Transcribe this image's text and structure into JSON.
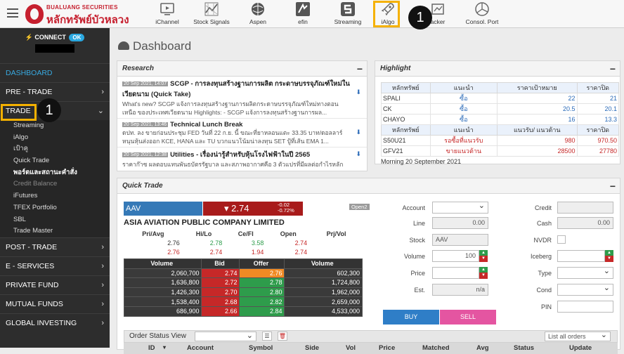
{
  "topbar": {
    "brand_line1": "BUALUANG SECURITIES",
    "brand_line2": "หลักทรัพย์บัวหลวง",
    "items": [
      {
        "label": "iChannel",
        "icon": "monitor-icon"
      },
      {
        "label": "Stock Signals",
        "icon": "signal-icon"
      },
      {
        "label": "Aspen",
        "icon": "globe-icon"
      },
      {
        "label": "efin",
        "icon": "efin-icon"
      },
      {
        "label": "Streaming",
        "icon": "streaming-icon"
      },
      {
        "label": "iAlgo",
        "icon": "rocket-icon"
      },
      {
        "label": "acker",
        "icon": "tracker-icon"
      },
      {
        "label": "Consol. Port",
        "icon": "pie-chart-icon"
      }
    ],
    "step_badge": "1"
  },
  "sidebar": {
    "connect_label": "CONNECT",
    "connect_status": "OK",
    "sections": [
      {
        "label": "DASHBOARD",
        "active": true
      },
      {
        "label": "PRE - TRADE"
      },
      {
        "label": "TRADE"
      }
    ],
    "trade_items": [
      {
        "label": "Streaming"
      },
      {
        "label": "iAlgo"
      },
      {
        "label": "เป้าคู"
      },
      {
        "label": "Quick Trade"
      },
      {
        "label": "พอร์ตและสถานะคำสั่ง"
      },
      {
        "label": "Credit Balance"
      },
      {
        "label": "iFutures"
      },
      {
        "label": "TFEX Portfolio"
      },
      {
        "label": "SBL"
      },
      {
        "label": "Trade Master"
      }
    ],
    "bottom_sections": [
      {
        "label": "POST - TRADE"
      },
      {
        "label": "E - SERVICES"
      },
      {
        "label": "PRIVATE FUND"
      },
      {
        "label": "MUTUAL FUNDS"
      },
      {
        "label": "GLOBAL INVESTING"
      }
    ],
    "step_badge": "1"
  },
  "main": {
    "title": "Dashboard",
    "research": {
      "title": "Research",
      "items": [
        {
          "date": "20 Sep 2021, 14:07",
          "headline": "SCGP - การลงทุนสร้างฐานการผลิต กระดาษบรรจุภัณฑ์ใหม่ใน",
          "line2": "เวียดนาม (Quick Take)",
          "body1": "What's new? SCGP แจ้งการลงทุนสร้างฐานการผลิตกระดาษบรรจุภัณฑ์ใหม่ทางตอน",
          "body2": "เหนือ ของประเทศเวียดนาม Highlights: - SCGP แจ้งการลงทุนสร้างฐานการผล..."
        },
        {
          "date": "20 Sep 2021, 13:46",
          "headline": "Technical Lunch Break",
          "body1": "ดปท. ลง ขายก่อนประชุม FED วันที่ 22 ก.ย. นี้ ขณะที่ยาหลอนแตะ 33.35 บาท/ดอลลาร์",
          "body2": "หนุนหุ้นส่งออก KCE, HANA และ TU บวกแนวโน้มน่าลงทุน SET ปู้ที่เส้น EMA 1..."
        },
        {
          "date": "20 Sep 2021, 12:38",
          "headline": "Utilities - เรื่องน่ารู้สำหรับหุ้นโรงไฟฟ้าในปี 2565",
          "body1": "ราคาก๊าซ ผลตอบแทนพันธบัตรรัฐบาล และสภาพอากาศคือ 3 ตัวแปรที่มีผลต่อกำไรหลัก"
        }
      ]
    },
    "highlight": {
      "title": "Highlight",
      "headers1": [
        "หลักทรัพย์",
        "แนะนำ",
        "ราคาเป้าหมาย",
        "ราคาปิด"
      ],
      "rows1": [
        {
          "sym": "SPALI",
          "rec": "ซื้อ",
          "target": "22",
          "close": "21"
        },
        {
          "sym": "CK",
          "rec": "ซื้อ",
          "target": "20.5",
          "close": "20.1"
        },
        {
          "sym": "CHAYO",
          "rec": "ซื้อ",
          "target": "16",
          "close": "13.3"
        }
      ],
      "headers2": [
        "หลักทรัพย์",
        "แนะนำ",
        "แนวรับ/ แนวต้าน",
        "ราคาปิด"
      ],
      "rows2": [
        {
          "sym": "S50U21",
          "rec": "รอซื้อที่แนวรับ",
          "level": "980",
          "close": "970.50"
        },
        {
          "sym": "GFV21",
          "rec": "ขายแนวต้าน",
          "level": "28500",
          "close": "27780"
        }
      ],
      "note": "Morning 20 September 2021"
    },
    "quick_trade": {
      "title": "Quick Trade",
      "symbol": "AAV",
      "last": "2.74",
      "change": "-0.02",
      "change_pct": "-0.72%",
      "session": "Open2",
      "company": "ASIA AVIATION PUBLIC COMPANY LIMITED",
      "stat_headers": [
        "Pri/Avg",
        "Hi/Lo",
        "Ce/Fl",
        "Open",
        "Prj/Vol"
      ],
      "stat_row1": [
        "2.76",
        "2.78",
        "3.58",
        "2.74",
        ""
      ],
      "stat_row2": [
        "2.76",
        "2.74",
        "1.94",
        "2.74",
        ""
      ],
      "mbo_headers": [
        "Volume",
        "Bid",
        "Offer",
        "Volume"
      ],
      "mbo_rows": [
        [
          "2,060,700",
          "2.74",
          "2.76",
          "602,300"
        ],
        [
          "1,636,800",
          "2.72",
          "2.78",
          "1,724,800"
        ],
        [
          "1,426,300",
          "2.70",
          "2.80",
          "1,962,000"
        ],
        [
          "1,538,400",
          "2.68",
          "2.82",
          "2,659,000"
        ],
        [
          "686,900",
          "2.66",
          "2.84",
          "4,533,000"
        ]
      ],
      "form": {
        "account_label": "Account",
        "account_value": "",
        "line_label": "Line",
        "line_value": "0.00",
        "stock_label": "Stock",
        "stock_value": "AAV",
        "volume_label": "Volume",
        "volume_value": "100",
        "price_label": "Price",
        "price_value": "",
        "est_label": "Est.",
        "est_value": "n/a",
        "credit_label": "Credit",
        "credit_value": "",
        "cash_label": "Cash",
        "cash_value": "0.00",
        "nvdr_label": "NVDR",
        "iceberg_label": "Iceberg",
        "iceberg_value": "",
        "type_label": "Type",
        "type_value": "",
        "cond_label": "Cond",
        "cond_value": "",
        "pin_label": "PIN",
        "pin_value": ""
      },
      "buy_label": "BUY",
      "sell_label": "SELL",
      "order_status_label": "Order Status View",
      "list_filter": "List all orders",
      "order_headers": [
        "ID",
        "Account",
        "Symbol",
        "Side",
        "Vol",
        "Price",
        "Matched",
        "Avg",
        "Status",
        "Update"
      ]
    }
  },
  "colors": {
    "accent": "#f5b100",
    "bid": "#c62828",
    "offer": "#2e9c4b",
    "buy": "#2f7ec7",
    "sell": "#e455a1"
  }
}
